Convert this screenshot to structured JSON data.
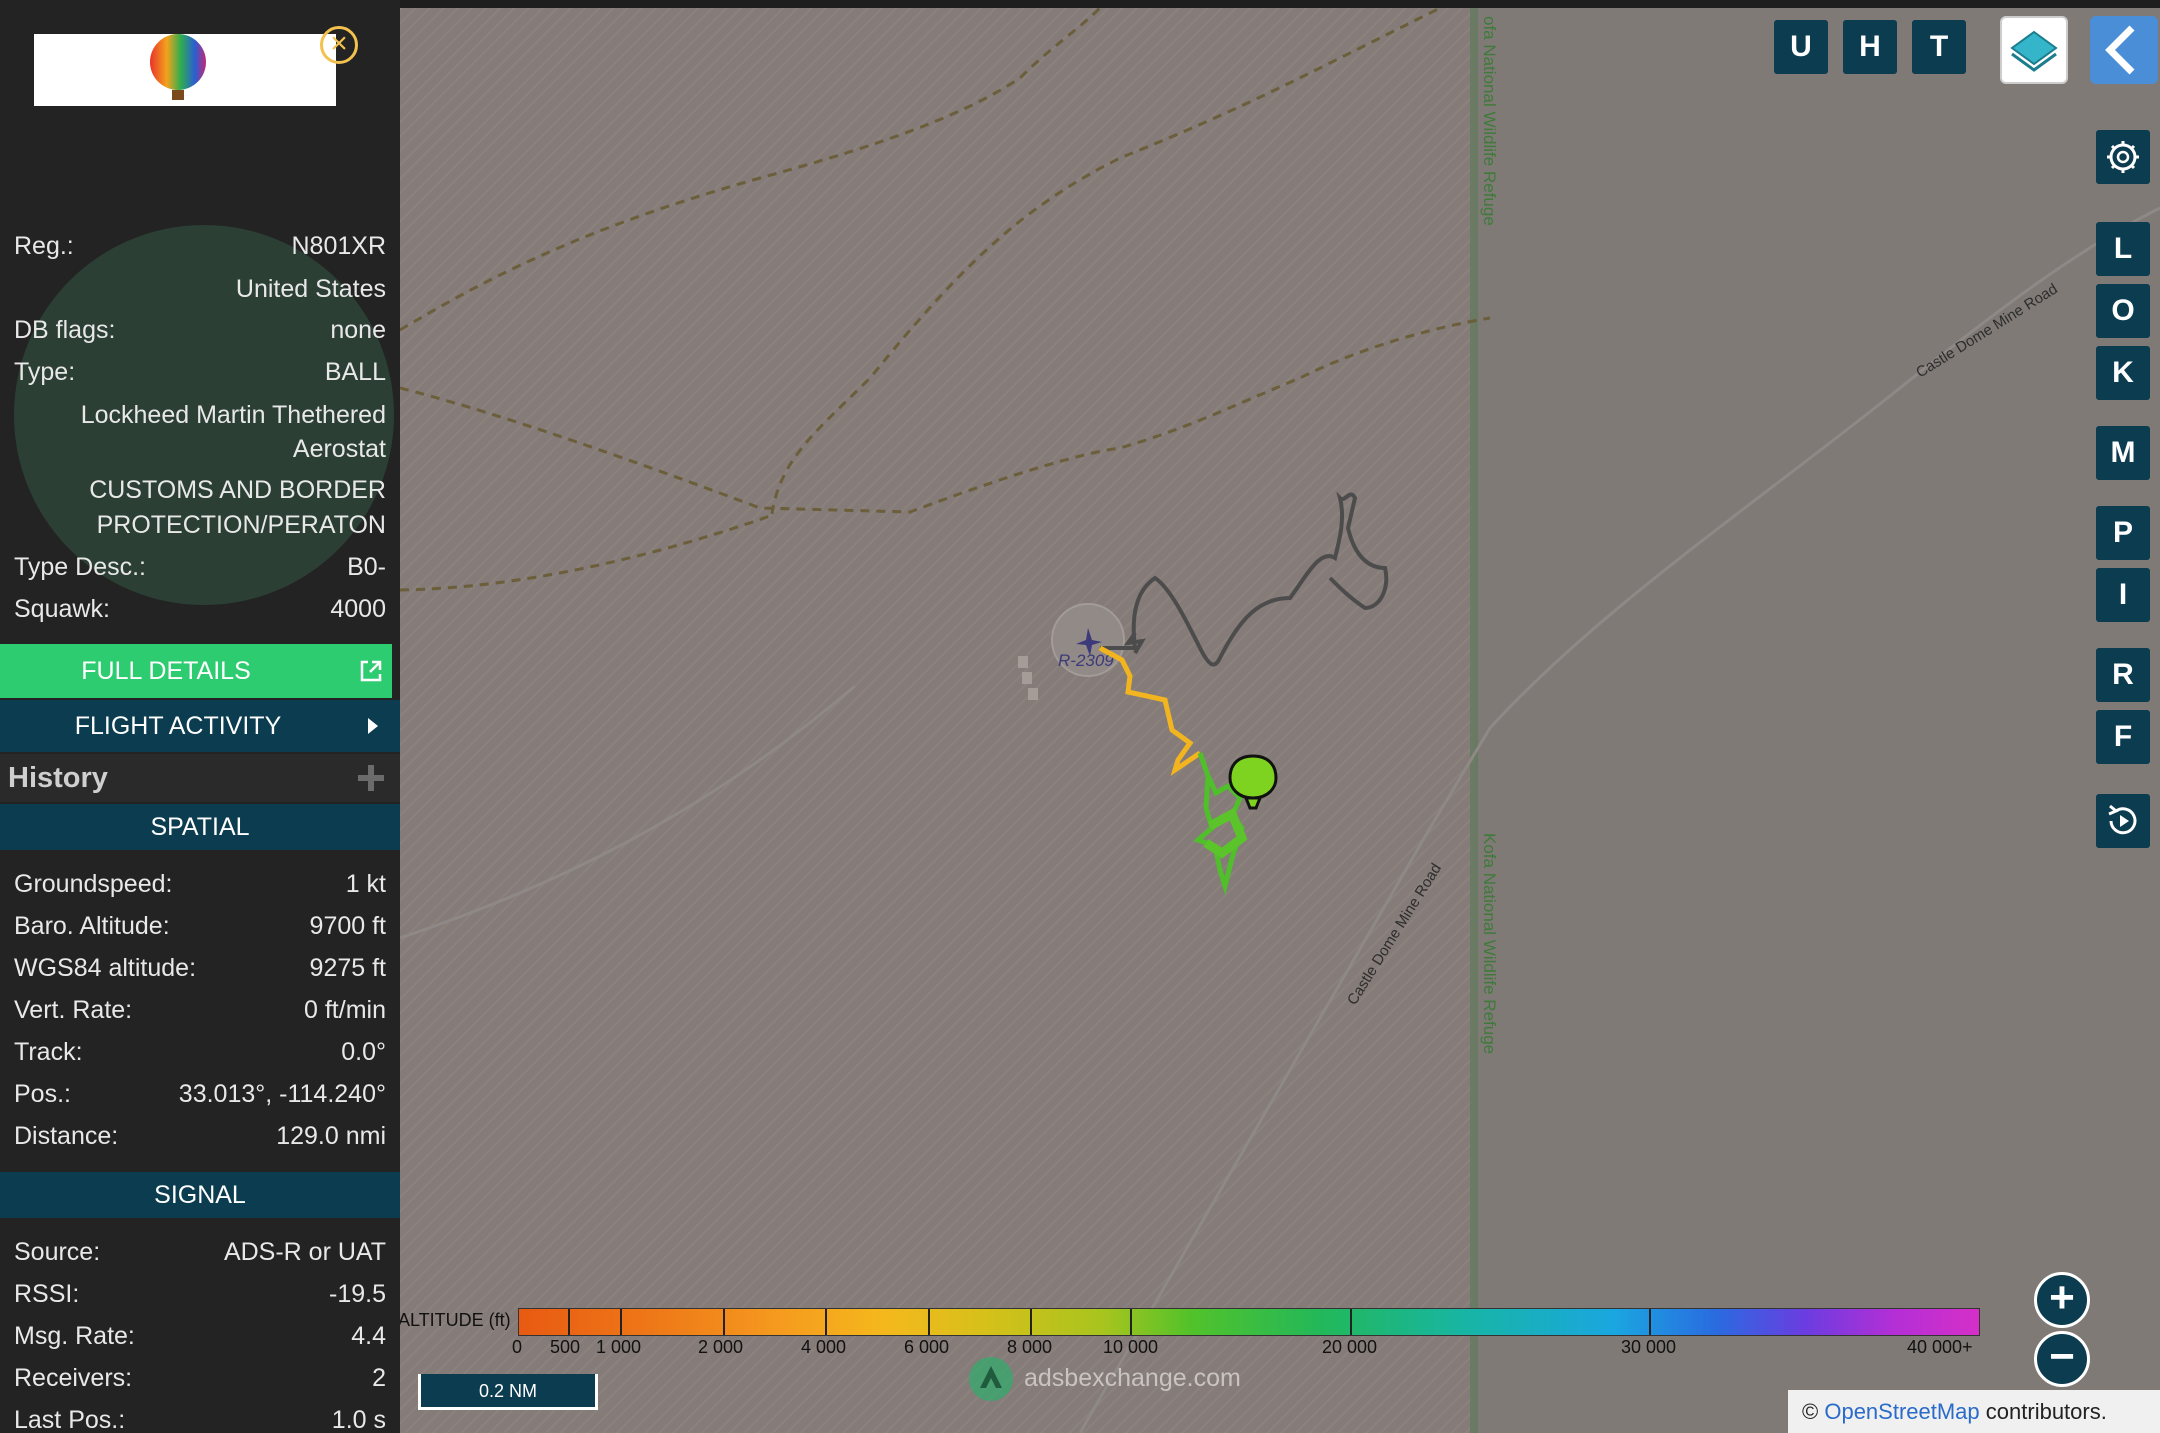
{
  "sidebar": {
    "close_symbol": "×",
    "reg_label": "Reg.:",
    "reg_value": "N801XR",
    "country": "United States",
    "dbflags_label": "DB flags:",
    "dbflags_value": "none",
    "type_label": "Type:",
    "type_value": "BALL",
    "type_name_line1": "Lockheed Martin Thethered",
    "type_name_line2": "Aerostat",
    "operator_line1": "CUSTOMS AND BORDER",
    "operator_line2": "PROTECTION/PERATON",
    "typedesc_label": "Type Desc.:",
    "typedesc_value": "B0-",
    "squawk_label": "Squawk:",
    "squawk_value": "4000",
    "full_details": "FULL DETAILS",
    "flight_activity": "FLIGHT ACTIVITY",
    "history": "History",
    "spatial_header": "SPATIAL",
    "spatial": [
      {
        "label": "Groundspeed:",
        "value": "1 kt"
      },
      {
        "label": "Baro. Altitude:",
        "value": "9700 ft"
      },
      {
        "label": "WGS84 altitude:",
        "value": "9275 ft"
      },
      {
        "label": "Vert. Rate:",
        "value": "0 ft/min"
      },
      {
        "label": "Track:",
        "value": "0.0°"
      },
      {
        "label": "Pos.:",
        "value": "33.013°, -114.240°"
      },
      {
        "label": "Distance:",
        "value": "129.0 nmi"
      }
    ],
    "signal_header": "SIGNAL",
    "signal": [
      {
        "label": "Source:",
        "value": "ADS-R or UAT"
      },
      {
        "label": "RSSI:",
        "value": "-19.5"
      },
      {
        "label": "Msg. Rate:",
        "value": "4.4"
      },
      {
        "label": "Receivers:",
        "value": "2"
      },
      {
        "label": "Last Pos.:",
        "value": "1.0 s"
      }
    ]
  },
  "map": {
    "refuge_label": "Kofa National Wildlife Refuge",
    "refuge_label_top": "ofa National Wildlife Refuge",
    "road_label": "Castle Dome Mine Road",
    "airspace_label": "R-2309",
    "top_buttons": [
      "U",
      "H",
      "T"
    ],
    "side_buttons": [
      "L",
      "O",
      "K",
      "M",
      "P",
      "I",
      "R",
      "F"
    ],
    "zoom_in": "+",
    "zoom_out": "−",
    "altitude_title": "ALTITUDE (ft)",
    "altitude_ticks": [
      "0",
      "500",
      "1 000",
      "2 000",
      "4 000",
      "6 000",
      "8 000",
      "10 000",
      "20 000",
      "30 000",
      "40 000+"
    ],
    "scale": "0.2 NM",
    "brand": "adsbexchange.com",
    "attribution_symbol": "©",
    "attribution_link": "OpenStreetMap",
    "attribution_rest": "contributors."
  }
}
